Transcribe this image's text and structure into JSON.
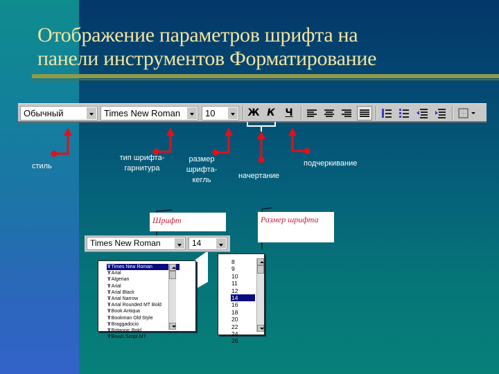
{
  "slide": {
    "title_line1": "Отображение параметров шрифта на",
    "title_line2": "панели инструментов Форматирование",
    "colors": {
      "title": "#f2e4a0",
      "arrow": "#e0101c",
      "callout_text": "#c0203a",
      "selection": "#0a0a80"
    }
  },
  "toolbar": {
    "style_value": "Обычный",
    "font_value": "Times New Roman",
    "size_value": "10",
    "bold_label": "Ж",
    "italic_label": "К",
    "underline_label": "Ч",
    "buttons": [
      "align-left",
      "align-center",
      "align-right",
      "justify",
      "numbered-list",
      "bulleted-list",
      "decrease-indent",
      "increase-indent",
      "borders"
    ]
  },
  "labels": {
    "style": "стиль",
    "font_type_1": "тип шрифта-",
    "font_type_2": "гарнитура",
    "font_size_1": "размер",
    "font_size_2": "шрифта-",
    "font_size_3": "кегль",
    "typeface_style": "начертание",
    "underline": "подчеркивание"
  },
  "callouts": {
    "font": "Шрифт",
    "font_size": "Размер шрифта"
  },
  "mini_toolbar": {
    "font_value": "Times New Roman",
    "size_value": "14"
  },
  "font_list": {
    "header": "Times New Roman",
    "items": [
      "Arial",
      "Algerian",
      "Arial",
      "Arial Black",
      "Arial Narrow",
      "Arial Rounded MT Bold",
      "Book Antiqua",
      "Bookman Old Style",
      "Braggadocio",
      "Britannic Bold",
      "Brush Script MT"
    ]
  },
  "size_list": {
    "items": [
      "8",
      "9",
      "10",
      "11",
      "12",
      "14",
      "16",
      "18",
      "20",
      "22",
      "24",
      "26"
    ],
    "selected": "14"
  }
}
